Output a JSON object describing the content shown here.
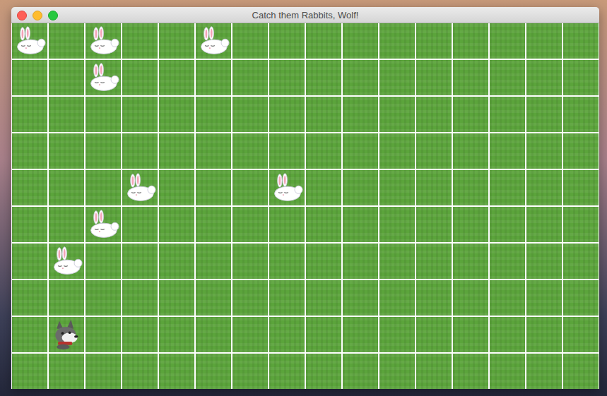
{
  "window": {
    "title": "Catch them Rabbits, Wolf!"
  },
  "board": {
    "columns": 16,
    "rows": 10,
    "pieces": [
      {
        "kind": "rabbit",
        "col": 0,
        "row": 0
      },
      {
        "kind": "rabbit",
        "col": 2,
        "row": 0
      },
      {
        "kind": "rabbit",
        "col": 5,
        "row": 0
      },
      {
        "kind": "rabbit",
        "col": 2,
        "row": 1
      },
      {
        "kind": "rabbit",
        "col": 3,
        "row": 4
      },
      {
        "kind": "rabbit",
        "col": 7,
        "row": 4
      },
      {
        "kind": "rabbit",
        "col": 2,
        "row": 5
      },
      {
        "kind": "rabbit",
        "col": 1,
        "row": 6
      },
      {
        "kind": "wolf",
        "col": 1,
        "row": 8
      }
    ]
  }
}
